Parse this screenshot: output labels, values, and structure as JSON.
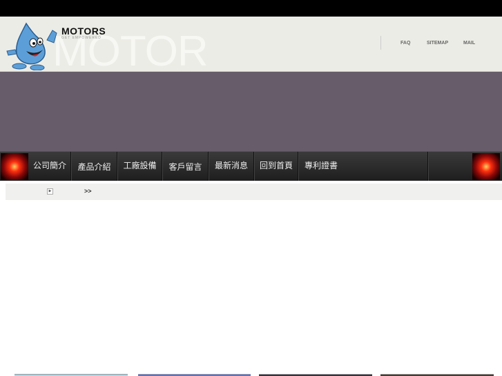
{
  "header": {
    "brand": "MOTORS",
    "tagline": "GET EMPOWERED",
    "watermark": "MOTOR",
    "links": [
      "FAQ",
      "SITEMAP",
      "MAIL"
    ]
  },
  "nav": {
    "items": [
      "公司簡介",
      "產品介紹",
      "工廠設備",
      "客戶留言",
      "最新消息",
      "回到首頁",
      "專利證書"
    ]
  },
  "breadcrumb": {
    "separator": ">>"
  },
  "colors": {
    "band": "#675d6a",
    "header": "#ecece6",
    "nav": "#2a2a2a"
  }
}
